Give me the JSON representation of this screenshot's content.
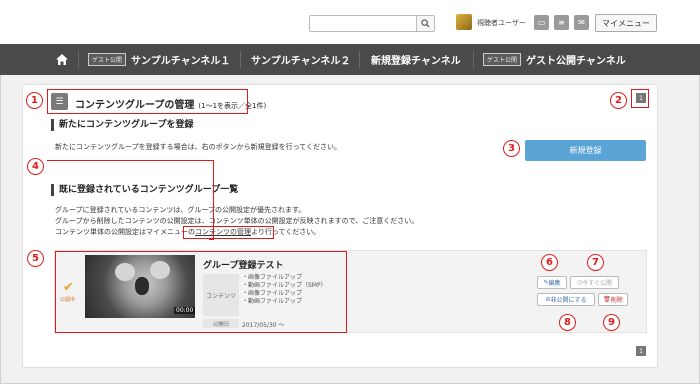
{
  "header": {
    "logo_text": "",
    "user_name": "視聴者ユーザー",
    "mymenu_label": "マイメニュー",
    "icons": [
      "search-icon",
      "avatar",
      "chat-icon",
      "document-icon",
      "mail-icon"
    ]
  },
  "nav": {
    "home_icon": "home-icon",
    "items": [
      {
        "badge": "ゲスト公開",
        "label": "サンプルチャンネル１"
      },
      {
        "badge": "",
        "label": "サンプルチャンネル２"
      },
      {
        "badge": "",
        "label": "新規登録チャンネル"
      },
      {
        "badge": "ゲスト公開",
        "label": "ゲスト公開チャンネル"
      }
    ]
  },
  "main": {
    "title": "コンテンツグループの管理",
    "count": "(1〜1を表示／全1件)",
    "register_heading": "新たにコンテンツグループを登録",
    "register_desc": "新たにコンテンツグループを登録する場合は、右のボタンから新規登録を行ってください。",
    "register_button": "新規登録",
    "list_heading": "既に登録されているコンテンツグループ一覧",
    "note1": "グループに登録されているコンテンツは、グループの公開設定が優先されます。",
    "note2": "グループから削除したコンテンツの公開設定は、コンテンツ単体の公開設定が反映されますので、ご注意ください。",
    "note3_a": "コンテンツ単体の公開設定はマイメニューの",
    "note3_link": "コンテンツの管理",
    "note3_b": "より行ってください。",
    "page_indicator": "1",
    "page_indicator_bottom": "1"
  },
  "group": {
    "status": "公開中",
    "duration": "00:00",
    "title": "グループ登録テスト",
    "content_label": "コンテンツ",
    "contents": [
      "・画像ファイルアップ",
      "・動画ファイルアップ（SMP）",
      "・画像ファイルアップ",
      "・動画ファイルアップ"
    ],
    "date_label": "公開日",
    "date": "2017/05/30 〜",
    "actions": {
      "edit": "編集",
      "publish_now": "今すぐ公開",
      "unpublish": "非公開にする",
      "delete": "削除"
    }
  },
  "annotations": [
    "1",
    "2",
    "3",
    "4",
    "5",
    "6",
    "7",
    "8",
    "9"
  ],
  "colors": {
    "nav_bg": "#4a4a4a",
    "primary_button": "#5aa5d6",
    "annotation": "#e01b1b",
    "published": "#f0a030"
  }
}
